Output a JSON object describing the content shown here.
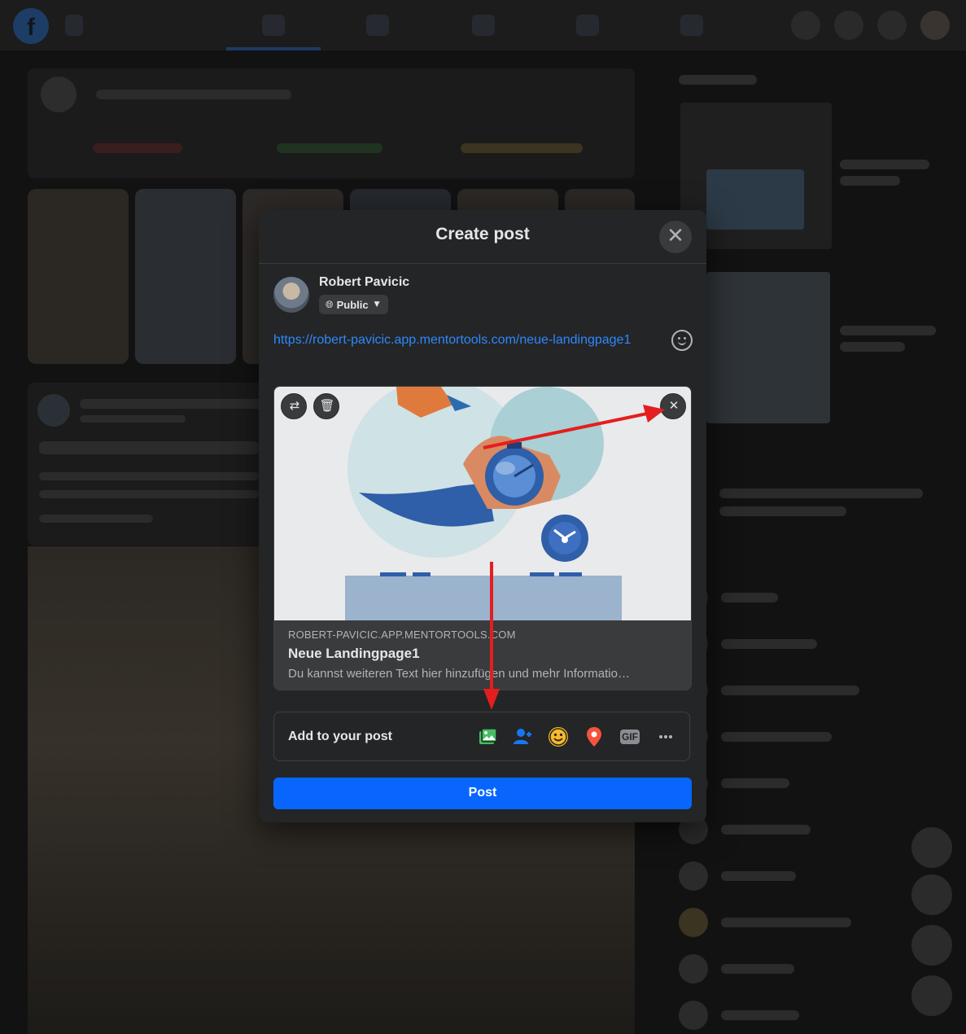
{
  "modal": {
    "title": "Create post",
    "close_icon": "close-icon"
  },
  "composer": {
    "user_name": "Robert Pavicic",
    "privacy_label": "Public",
    "post_text": "https://robert-pavicic.app.mentortools.com/neue-landingpage1"
  },
  "link_preview": {
    "domain": "ROBERT-PAVICIC.APP.MENTORTOOLS.COM",
    "title": "Neue Landingpage1",
    "description": "Du kannst weiteren Text hier hinzufügen und mehr Informatio…"
  },
  "add_to_post": {
    "label": "Add to your post",
    "icons": [
      "photo-video-icon",
      "tag-people-icon",
      "feeling-icon",
      "check-in-icon",
      "gif-icon",
      "more-icon"
    ],
    "gif_label": "GIF"
  },
  "post_button_label": "Post",
  "colors": {
    "accent": "#0866ff",
    "link": "#2d88ff",
    "modal_bg": "#242526",
    "annotation_arrow": "#e41e1e"
  }
}
